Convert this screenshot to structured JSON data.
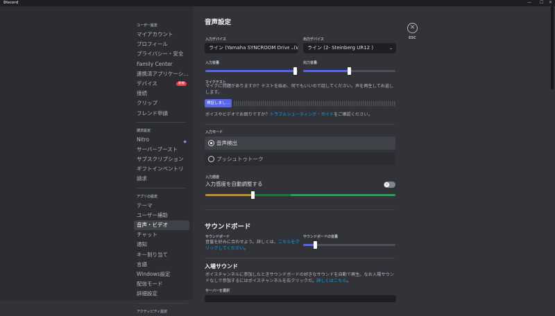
{
  "window": {
    "title": "Discord",
    "controls": [
      "—",
      "☐",
      "✕"
    ]
  },
  "sidebar": {
    "sections": [
      {
        "header": "ユーザー設定",
        "items": [
          {
            "label": "マイアカウント"
          },
          {
            "label": "プロフィール"
          },
          {
            "label": "プライバシー・安全"
          },
          {
            "label": "Family Center"
          },
          {
            "label": "連携済アプリケーション"
          },
          {
            "label": "デバイス",
            "badge": "新規"
          },
          {
            "label": "接続"
          },
          {
            "label": "クリップ"
          },
          {
            "label": "フレンド申請"
          }
        ]
      },
      {
        "header": "請求設定",
        "items": [
          {
            "label": "Nitro"
          },
          {
            "label": "サーバーブースト"
          },
          {
            "label": "サブスクリプション"
          },
          {
            "label": "ギフトインベントリ"
          },
          {
            "label": "請求"
          }
        ]
      },
      {
        "header": "アプリの設定",
        "items": [
          {
            "label": "テーマ"
          },
          {
            "label": "ユーザー補助"
          },
          {
            "label": "音声・ビデオ",
            "active": true
          },
          {
            "label": "チャット"
          },
          {
            "label": "通知"
          },
          {
            "label": "キー割り当て"
          },
          {
            "label": "言語"
          },
          {
            "label": "Windows設定"
          },
          {
            "label": "配信モード"
          },
          {
            "label": "詳細設定"
          }
        ]
      },
      {
        "header": "アクティビティ設定"
      }
    ]
  },
  "main": {
    "title": "音声設定",
    "close": {
      "icon": "close-icon",
      "label": "ESC"
    },
    "input_device": {
      "label": "入力デバイス",
      "value": "ライン (Yamaha SYNCROOM Driver (WDM))"
    },
    "output_device": {
      "label": "出力デバイス",
      "value": "ライン (2- Steinberg UR12 )"
    },
    "input_volume": {
      "label": "入力音量",
      "value": 97
    },
    "output_volume": {
      "label": "出力音量",
      "value": 50
    },
    "mic_test": {
      "label": "マイクテスト",
      "description": "マイクに問題がありますか？テストを始め、何でもいいので話してください。声を再生してお返しします。",
      "button": "検証しまし…"
    },
    "help": {
      "prefix": "ボイスやビデオでお困りですか？",
      "link": "トラブルシューティング・ガイド",
      "suffix": "をご確認ください。"
    },
    "input_mode": {
      "label": "入力モード",
      "options": [
        {
          "label": "音声検出",
          "selected": true
        },
        {
          "label": "プッシュトゥトーク",
          "selected": false
        }
      ]
    },
    "sensitivity": {
      "label": "入力感度",
      "auto_label": "入力感度を自動調整する",
      "auto_enabled": false,
      "value": 25
    },
    "soundboard": {
      "title": "サウンドボード",
      "label": "サウンドボード",
      "description": "音量を好みに合わせよう。詳しくは、",
      "link": "こちらをクリックしてください",
      "suffix": "。",
      "volume_label": "サウンドボードの音量",
      "volume": 13
    },
    "entrance": {
      "title": "入場サウンド",
      "description": "ボイスチャンネルに参加したときサウンドボードの好きなサウンドを自動で再生。なお入場サウンドなしで参加するにはボイスチャンネルを右クリックだ。",
      "link": "詳しくはこちら",
      "suffix": "。",
      "server_label": "サーバーを選択"
    }
  },
  "colors": {
    "accent": "#5865f2",
    "link": "#00a8fc",
    "sens_low": "#c48f27",
    "sens_high": "#23a559"
  }
}
